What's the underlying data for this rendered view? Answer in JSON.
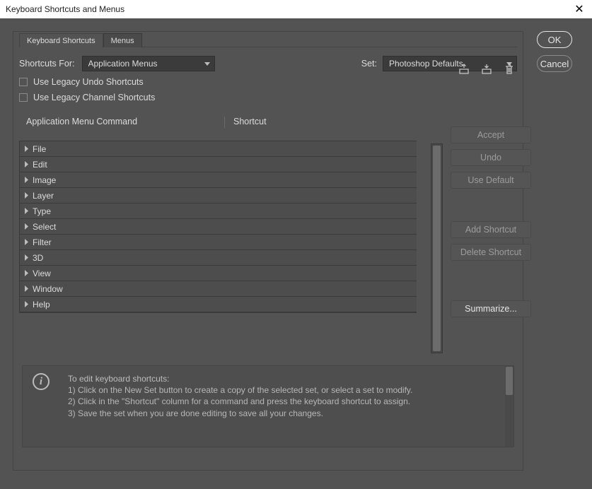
{
  "window": {
    "title": "Keyboard Shortcuts and Menus"
  },
  "dialog_buttons": {
    "ok": "OK",
    "cancel": "Cancel"
  },
  "tabs": {
    "active": "Keyboard Shortcuts",
    "inactive": "Menus"
  },
  "controls": {
    "shortcuts_for_label": "Shortcuts For:",
    "shortcuts_for_value": "Application Menus",
    "set_label": "Set:",
    "set_value": "Photoshop Defaults",
    "legacy_undo": "Use Legacy Undo Shortcuts",
    "legacy_channel": "Use Legacy Channel Shortcuts"
  },
  "columns": {
    "command": "Application Menu Command",
    "shortcut": "Shortcut"
  },
  "tree_items": [
    "File",
    "Edit",
    "Image",
    "Layer",
    "Type",
    "Select",
    "Filter",
    "3D",
    "View",
    "Window",
    "Help"
  ],
  "side_buttons": {
    "accept": "Accept",
    "undo": "Undo",
    "use_default": "Use Default",
    "add_shortcut": "Add Shortcut",
    "delete_shortcut": "Delete Shortcut",
    "summarize": "Summarize..."
  },
  "info": {
    "heading": "To edit keyboard shortcuts:",
    "line1": "1) Click on the New Set button to create a copy of the selected set, or select a set to modify.",
    "line2": "2) Click in the \"Shortcut\" column for a command and press the keyboard shortcut to assign.",
    "line3": "3) Save the set when you are done editing to save all your changes."
  }
}
